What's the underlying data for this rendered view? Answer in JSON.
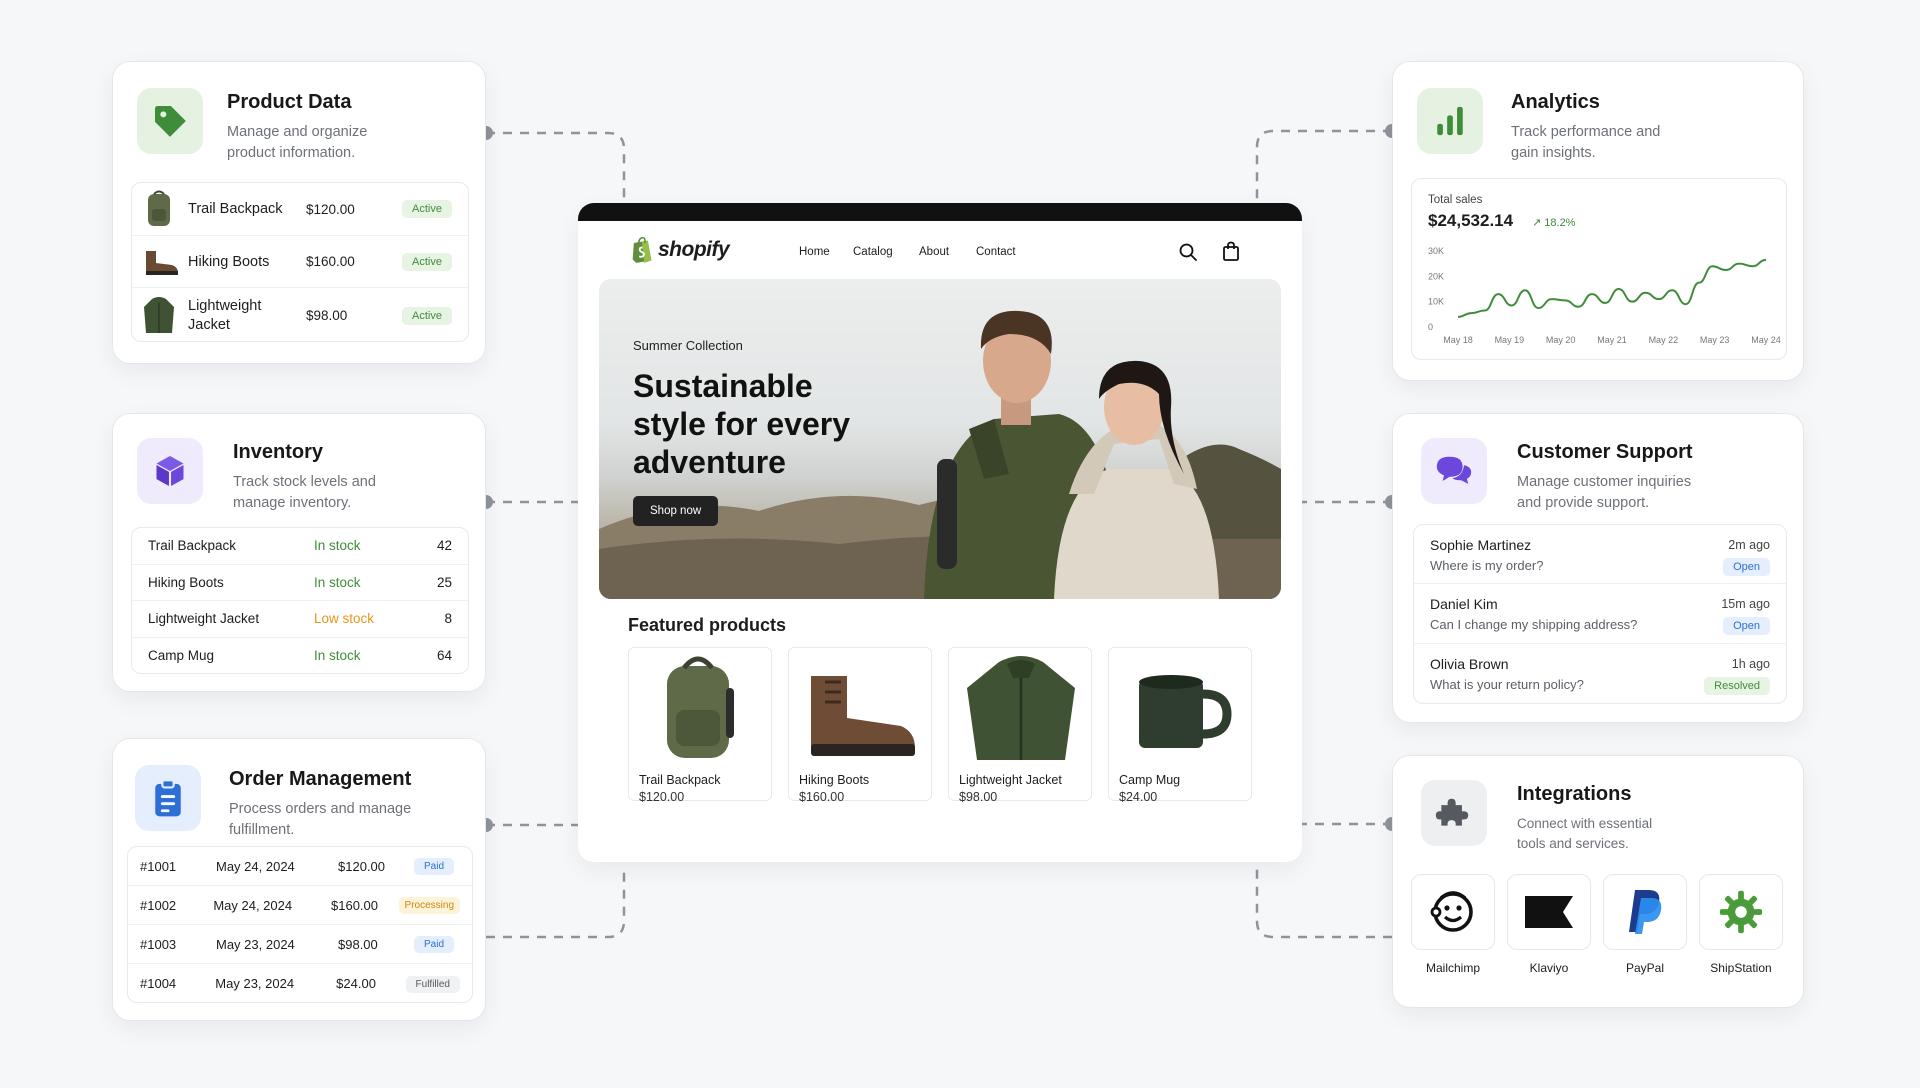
{
  "colors": {
    "green": "#3f8d3a",
    "green_bg": "#e7f3e3",
    "purple": "#6b47dc",
    "purple_bg": "#efeafc",
    "blue": "#2d6fd6",
    "blue_bg": "#e5eefc",
    "orange": "#e8941a"
  },
  "product_data": {
    "title": "Product Data",
    "description": "Manage and organize product information.",
    "icon": "tag-icon",
    "items": [
      {
        "name": "Trail Backpack",
        "price": "$120.00",
        "status": "Active"
      },
      {
        "name": "Hiking Boots",
        "price": "$160.00",
        "status": "Active"
      },
      {
        "name": "Lightweight Jacket",
        "price": "$98.00",
        "status": "Active"
      }
    ]
  },
  "inventory": {
    "title": "Inventory",
    "description": "Track stock levels and manage inventory.",
    "icon": "box-icon",
    "items": [
      {
        "name": "Trail Backpack",
        "status": "In stock",
        "qty": "42"
      },
      {
        "name": "Hiking Boots",
        "status": "In stock",
        "qty": "25"
      },
      {
        "name": "Lightweight Jacket",
        "status": "Low stock",
        "qty": "8"
      },
      {
        "name": "Camp Mug",
        "status": "In stock",
        "qty": "64"
      }
    ]
  },
  "orders": {
    "title": "Order Management",
    "description": "Process orders and manage fulfillment.",
    "icon": "clipboard-icon",
    "items": [
      {
        "id": "#1001",
        "date": "May 24, 2024",
        "amount": "$120.00",
        "status": "Paid"
      },
      {
        "id": "#1002",
        "date": "May 24, 2024",
        "amount": "$160.00",
        "status": "Processing"
      },
      {
        "id": "#1003",
        "date": "May 23, 2024",
        "amount": "$98.00",
        "status": "Paid"
      },
      {
        "id": "#1004",
        "date": "May 23, 2024",
        "amount": "$24.00",
        "status": "Fulfilled"
      }
    ]
  },
  "analytics": {
    "title": "Analytics",
    "description": "Track performance and gain insights.",
    "icon": "bar-chart-icon",
    "total_label": "Total sales",
    "total_value": "$24,532.14",
    "change": "↗ 18.2%"
  },
  "chart_data": {
    "type": "line",
    "x": [
      "May 18",
      "May 19",
      "May 20",
      "May 21",
      "May 22",
      "May 23",
      "May 24"
    ],
    "y_ticks": [
      "30K",
      "20K",
      "10K",
      "0"
    ],
    "ylim": [
      0,
      30000
    ],
    "series": [
      {
        "values": [
          4000,
          5500,
          6500,
          13000,
          8500,
          14500,
          7500,
          11000,
          10500,
          8000,
          13000,
          9500,
          15000,
          10000,
          13500,
          11000,
          14500,
          9000,
          17500,
          24000,
          22500,
          25000,
          24000,
          26500
        ]
      }
    ]
  },
  "support": {
    "title": "Customer Support",
    "description": "Manage customer inquiries and provide support.",
    "icon": "chat-bubbles-icon",
    "tickets": [
      {
        "name": "Sophie Martinez",
        "message": "Where is my order?",
        "time": "2m ago",
        "status": "Open"
      },
      {
        "name": "Daniel Kim",
        "message": "Can I change my shipping address?",
        "time": "15m ago",
        "status": "Open"
      },
      {
        "name": "Olivia Brown",
        "message": "What is your return policy?",
        "time": "1h ago",
        "status": "Resolved"
      }
    ]
  },
  "integrations": {
    "title": "Integrations",
    "description": "Connect with essential tools and services.",
    "icon": "puzzle-icon",
    "apps": [
      {
        "name": "Mailchimp",
        "icon": "mailchimp-icon"
      },
      {
        "name": "Klaviyo",
        "icon": "klaviyo-icon"
      },
      {
        "name": "PayPal",
        "icon": "paypal-icon"
      },
      {
        "name": "ShipStation",
        "icon": "shipstation-gear-icon"
      }
    ]
  },
  "store": {
    "brand": "shopify",
    "nav": [
      "Home",
      "Catalog",
      "About",
      "Contact"
    ],
    "hero_eyebrow": "Summer Collection",
    "hero_title": "Sustainable style for every adventure",
    "hero_cta": "Shop now",
    "featured_title": "Featured products",
    "products": [
      {
        "name": "Trail Backpack",
        "price": "$120.00"
      },
      {
        "name": "Hiking Boots",
        "price": "$160.00"
      },
      {
        "name": "Lightweight Jacket",
        "price": "$98.00"
      },
      {
        "name": "Camp Mug",
        "price": "$24.00"
      }
    ]
  }
}
